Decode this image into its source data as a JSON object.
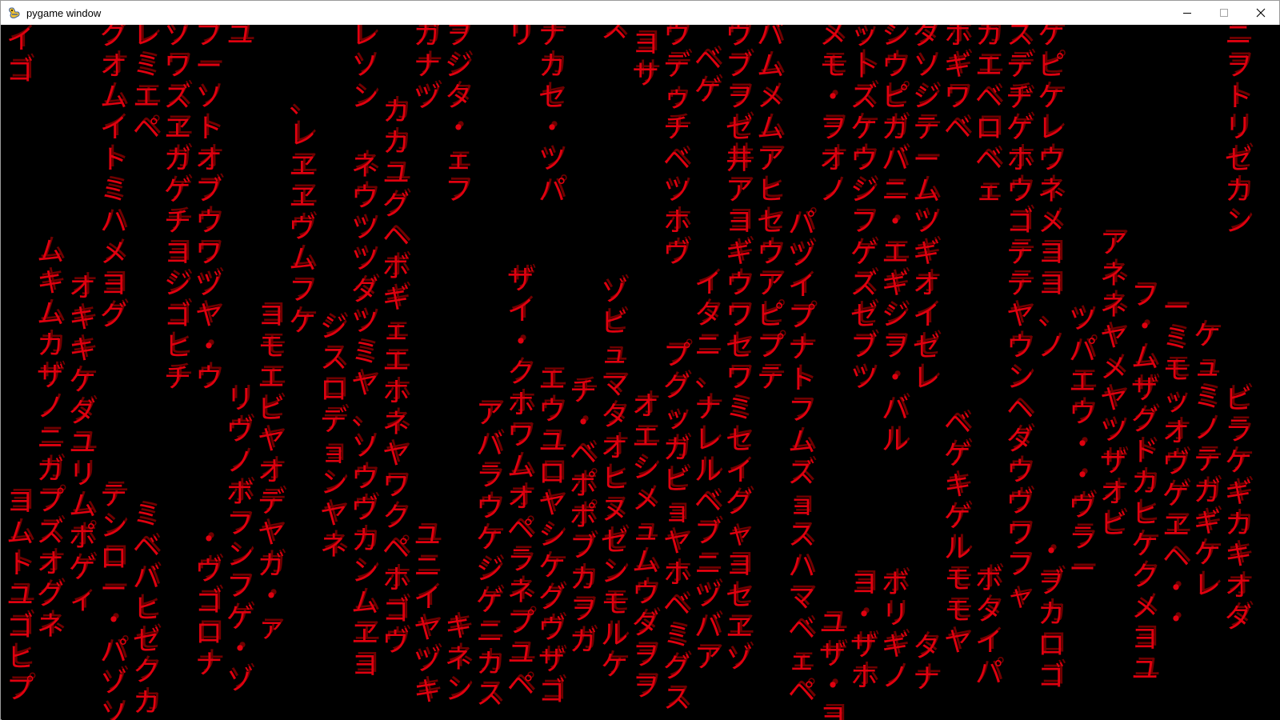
{
  "window": {
    "title": "pygame window",
    "icon": "pygame-snake-icon",
    "controls": {
      "minimize": "minimize-icon",
      "maximize": "maximize-icon",
      "close": "close-icon"
    }
  },
  "matrix": {
    "glyph_color": "#e0000f",
    "shadow_color": "#820000",
    "background": "#000000",
    "columns": [
      "イゴ",
      "グオムイトミハメヨグ",
      "ムキムカザノニガプズオグネ",
      "ヨムトユゴヒプ",
      "オキキケダユリムポゲィ",
      "テンロー・パゾソ",
      "レミエペ",
      "ミベバヒゼクカ",
      "ゾワズヱガゲチヨジゴヒチ",
      "ブーソトオブウワヅヤ・ウ",
      "ユ",
      "リヴノボフンフゲ・ゾ",
      "・ヴゴロナ",
      "ヨモエビヤオデヤガ・ァ",
      "、レヱヱヴムフケ",
      "ジスロデョンヤネ",
      "レソン",
      "ネウツツダツミヤ、ソウヴカンムヱヨ",
      "カカユグヘボギェエホネヤワクペホゴヴ",
      "ガナヅ",
      "ユニイヤヅキ",
      "ヲジタ・ェフ",
      "キネン",
      "アバラウケジゲニカス",
      "リ",
      "ザイ・クホワムオペラネプユペ",
      "ナカセ・ツパ",
      "エウユロヤシケグヴザゴ",
      "チ・ベポポブカヲガ",
      "ス",
      "ゾビュマタオヒヌゼンモルケ",
      "ヨサ",
      "オエシメュムウダヲヲ",
      "ウデゥチベツホヴ",
      "プグッガビョヤホベミグス",
      "ベゲ",
      "イタニ、ナレルベブニヅバア",
      "ヴブヲゼ井アヨギウワセワミセイグャヨセヱゾ",
      "バムメムアヒセウアピプテ",
      "パヅイプナトフムズョスハマベェペ",
      "メモ・ヲオノ",
      "ユザ・ヨ",
      "ッ卜ズケウジフゲズゼブツ",
      "ヨ・ザホ",
      "シウピガバニ・エギジヲ・バル",
      "ボリギノ",
      "ダソジテームツギオイゼレ",
      "タナ",
      "ホギワベ",
      "ベゲキゲルモモヤ",
      "カエベロベェ",
      "ボタイパ",
      "スデヂゲホウゴテテヤウンヘダウヴワフャ",
      "ケピケレウネメヨヨ、ノ",
      "・ヺカロゴ",
      "アネネヤメヤツザオビ",
      "ツパエウ・・ヴラー",
      "フ・ムザグドカヒケクメヨユ",
      "ーミモッオヴゲヱヘ・・",
      "ケュミノテガギケレ",
      "ニヲトリゼカン",
      "ビラケギカキオダ"
    ]
  }
}
